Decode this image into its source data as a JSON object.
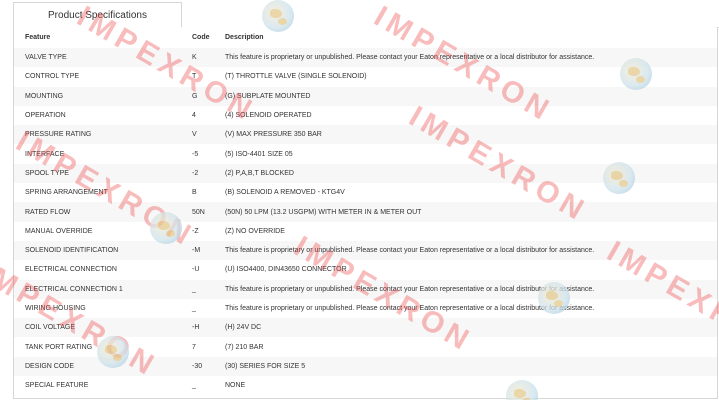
{
  "tab": {
    "label": "Product Specifications"
  },
  "table": {
    "headers": {
      "feature": "Feature",
      "code": "Code",
      "description": "Description"
    },
    "rows": [
      {
        "feature": "VALVE TYPE",
        "code": "K",
        "description": "This feature is proprietary or unpublished. Please contact your Eaton representative or a local distributor for assistance."
      },
      {
        "feature": "CONTROL TYPE",
        "code": "T",
        "description": "(T) THROTTLE VALVE (SINGLE SOLENOID)"
      },
      {
        "feature": "MOUNTING",
        "code": "G",
        "description": "(G) SUBPLATE MOUNTED"
      },
      {
        "feature": "OPERATION",
        "code": "4",
        "description": "(4) SOLENOID OPERATED"
      },
      {
        "feature": "PRESSURE RATING",
        "code": "V",
        "description": "(V) MAX PRESSURE 350 BAR"
      },
      {
        "feature": "INTERFACE",
        "code": "-5",
        "description": "(5) ISO-4401 SIZE 05"
      },
      {
        "feature": "SPOOL TYPE",
        "code": "-2",
        "description": "(2) P,A,B,T BLOCKED"
      },
      {
        "feature": "SPRING ARRANGEMENT",
        "code": "B",
        "description": "(B) SOLENOID A REMOVED - KTG4V"
      },
      {
        "feature": "RATED FLOW",
        "code": "50N",
        "description": "(50N) 50 LPM (13.2 USGPM) WITH METER IN & METER OUT"
      },
      {
        "feature": "MANUAL OVERRIDE",
        "code": "-Z",
        "description": "(Z) NO OVERRIDE"
      },
      {
        "feature": "SOLENOID IDENTIFICATION",
        "code": "-M",
        "description": "This feature is proprietary or unpublished. Please contact your Eaton representative or a local distributor for assistance."
      },
      {
        "feature": "ELECTRICAL CONNECTION",
        "code": "-U",
        "description": "(U) ISO4400, DIN43650 CONNECTOR"
      },
      {
        "feature": "ELECTRICAL CONNECTION 1",
        "code": "_",
        "description": "This feature is proprietary or unpublished. Please contact your Eaton representative or a local distributor for assistance."
      },
      {
        "feature": "WIRING HOUSING",
        "code": "_",
        "description": "This feature is proprietary or unpublished. Please contact your Eaton representative or a local distributor for assistance."
      },
      {
        "feature": "COIL VOLTAGE",
        "code": "-H",
        "description": "(H) 24V DC"
      },
      {
        "feature": "TANK PORT RATING",
        "code": "7",
        "description": "(7) 210 BAR"
      },
      {
        "feature": "DESIGN CODE",
        "code": "-30",
        "description": "(30) SERIES FOR SIZE 5"
      },
      {
        "feature": "SPECIAL FEATURE",
        "code": "_",
        "description": "NONE"
      }
    ]
  },
  "watermark": {
    "text": "IMPEXRON",
    "color": "#ee5050"
  }
}
